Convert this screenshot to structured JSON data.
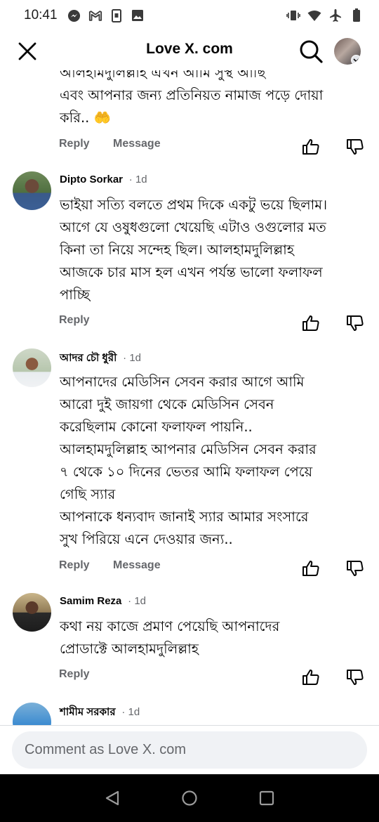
{
  "status_bar": {
    "time": "10:41",
    "left_icons": [
      "messenger-icon",
      "gmail-icon",
      "sim-icon",
      "image-icon"
    ],
    "right_icons": [
      "vibrate-icon",
      "wifi-icon",
      "airplane-icon",
      "battery-icon"
    ]
  },
  "header": {
    "title": "Love X. com",
    "close_icon": "close-icon",
    "search_icon": "search-icon"
  },
  "feed": {
    "cut_comment": {
      "partial_line": "আলহামদুলিল্লাহ এখন আমি সুস্থ আছি",
      "text": "এবং আপনার জন্য প্রতিনিয়ত নামাজ পড়ে দোয়া\nকরি.. 🤲",
      "actions": {
        "reply": "Reply",
        "message": "Message"
      }
    },
    "comments": [
      {
        "name": "Dipto Sorkar",
        "time": "· 1d",
        "text": "ভাইয়া সত্যি বলতে  প্রথম দিকে একটু ভয়ে ছিলাম।\nআগে যে ওষুধগুলো খেয়েছি এটাও ওগুলোর মত\nকিনা তা নিয়ে সন্দেহ ছিল। আলহামদুলিল্লাহ\nআজকে চার মাস হল এখন পর্যন্ত ভালো ফলাফল\nপাচ্ছি",
        "actions": {
          "reply": "Reply"
        }
      },
      {
        "name": "আদর চৌ ধুরী",
        "time": "· 1d",
        "text": "আপনাদের মেডিসিন সেবন করার আগে আমি\nআরো দুই জায়গা থেকে মেডিসিন সেবন\nকরেছিলাম কোনো ফলাফল পায়নি..\nআলহামদুলিল্লাহ আপনার মেডিসিন সেবন করার\n৭ থেকে ১০ দিনের ভেতর আমি ফলাফল পেয়ে\nগেছি স্যার\nআপনাকে ধন্যবাদ জানাই স্যার আমার সংসারে\nসুখ পিরিয়ে এনে দেওয়ার জন্য..",
        "actions": {
          "reply": "Reply",
          "message": "Message"
        }
      },
      {
        "name": "Samim Reza",
        "time": "· 1d",
        "text": "কথা নয় কাজে প্রমাণ পেয়েছি আপনাদের\nপ্রোডাক্টে আলহামদুলিল্লাহ",
        "actions": {
          "reply": "Reply"
        }
      },
      {
        "name": "শামীম সরকার",
        "time": "· 1d"
      }
    ]
  },
  "comment_bar": {
    "placeholder": "Comment as Love X. com"
  },
  "nav": {
    "back_icon": "back-icon",
    "home_icon": "home-icon",
    "recents_icon": "recents-icon"
  },
  "colors": {
    "text": "#050505",
    "secondary": "#65676b",
    "input_bg": "#f0f2f5",
    "nav_bg": "#000000"
  }
}
